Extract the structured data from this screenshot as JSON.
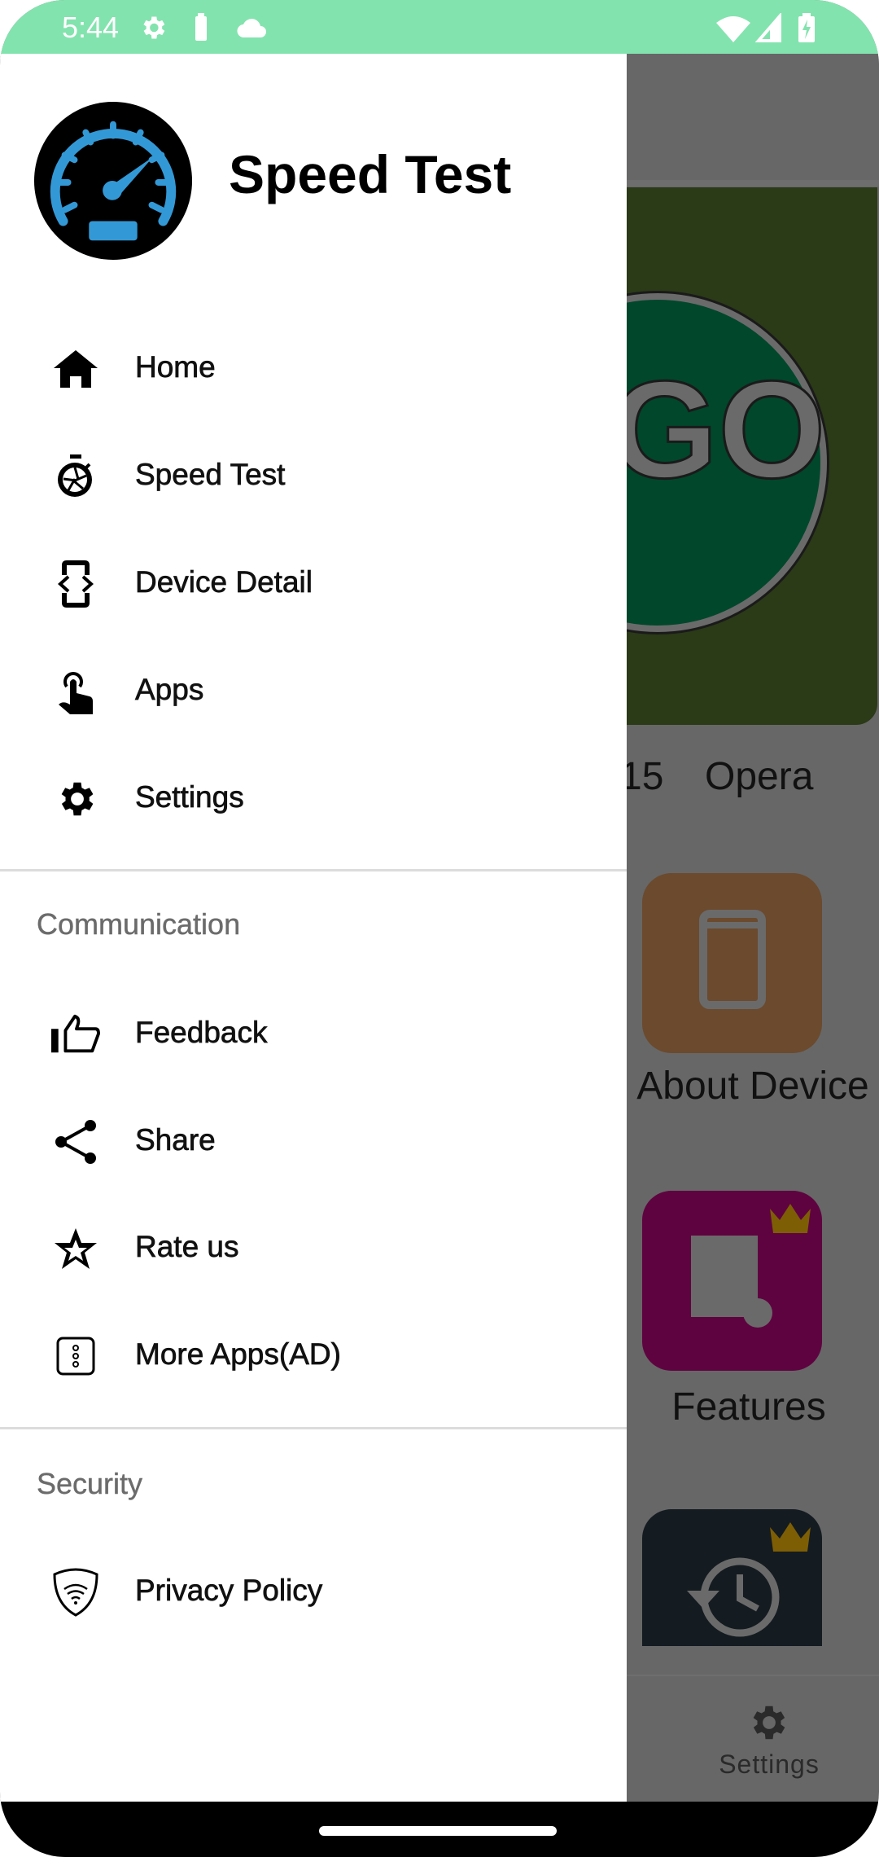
{
  "status_bar": {
    "time": "5:44",
    "left_icons": [
      "gear-icon",
      "battery-saver-icon",
      "cloud-icon"
    ],
    "right_icons": [
      "wifi-icon",
      "signal-icon",
      "battery-charging-icon"
    ],
    "color": "#83e3ae"
  },
  "drawer": {
    "app_title": "Speed Test",
    "logo_icon": "speedometer-icon",
    "main_items": [
      {
        "label": "Home",
        "icon": "home-icon"
      },
      {
        "label": "Speed Test",
        "icon": "stopwatch-icon"
      },
      {
        "label": "Device Detail",
        "icon": "device-code-icon"
      },
      {
        "label": "Apps",
        "icon": "touch-app-icon"
      },
      {
        "label": "Settings",
        "icon": "gear-icon"
      }
    ],
    "communication": {
      "title": "Communication",
      "items": [
        {
          "label": "Feedback",
          "icon": "thumbs-up-icon"
        },
        {
          "label": "Share",
          "icon": "share-icon"
        },
        {
          "label": "Rate us",
          "icon": "star-icon"
        },
        {
          "label": "More Apps(AD)",
          "icon": "more-apps-icon"
        }
      ]
    },
    "security": {
      "title": "Security",
      "items": [
        {
          "label": "Privacy Policy",
          "icon": "shield-wifi-icon"
        }
      ]
    }
  },
  "background": {
    "card_button": "GO",
    "info_partial": [
      "15",
      "Opera"
    ],
    "tiles": [
      {
        "label": "About Device",
        "color": "#6b4a2e"
      },
      {
        "label": "Features",
        "color": "#5f0340"
      },
      {
        "label": "",
        "color": "#141b21"
      }
    ],
    "bottom_nav": {
      "settings_label": "Settings"
    }
  }
}
